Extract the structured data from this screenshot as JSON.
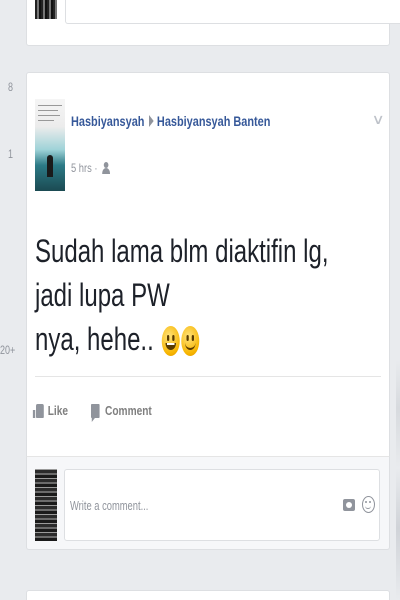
{
  "gutter": {
    "numbers": [
      "8",
      "1",
      "20+"
    ]
  },
  "post": {
    "author": "Hasbiyansyah",
    "target": "Hasbiyansyah Banten",
    "timestamp": "5 hrs",
    "privacy_icon": "friends-icon",
    "menu_icon": "chevron-down-icon",
    "text_line1": "Sudah lama blm diaktifin lg, jadi lupa PW",
    "text_line2": "nya, hehe..",
    "emojis": [
      "grinning-face-icon",
      "smiling-face-icon"
    ],
    "actions": {
      "like_label": "Like",
      "comment_label": "Comment"
    }
  },
  "composer": {
    "placeholder": "Write a comment...",
    "icons": [
      "camera-icon",
      "smiley-icon"
    ]
  },
  "colors": {
    "background": "#e9ebee",
    "card": "#ffffff",
    "link": "#365899",
    "muted": "#90949c",
    "text": "#1d2129"
  }
}
